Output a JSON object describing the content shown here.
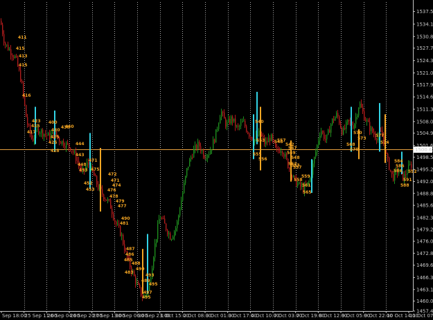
{
  "colors": {
    "background": "#000000",
    "bull": "#1e8c1e",
    "bear": "#b01c1c",
    "cyan_bar": "#33d4e6",
    "orange_bar": "#f5a623",
    "level_line": "#e8a040",
    "axis": "#c8c8c8",
    "grid": "#ffffff"
  },
  "chart_data": {
    "type": "candlestick",
    "ylim": [
      1457.4,
      1540.0
    ],
    "y_ticks": [
      "1537.50",
      "1534.10",
      "1530.80",
      "1527.70",
      "1524.35",
      "1521.05",
      "1517.95",
      "1514.65",
      "1511.35",
      "1508.05",
      "1504.95",
      "1501.65",
      "1498.55",
      "1495.25",
      "1492.05",
      "1488.85",
      "1485.65",
      "1482.35",
      "1479.25",
      "1476.05",
      "1472.85",
      "1469.65",
      "1466.35",
      "1463.15",
      "1460.05",
      "1457.40"
    ],
    "x_ticks": [
      "Sep 18:00",
      "25 Sep 11:00",
      "26 Sep 04:00",
      "26 Sep 20:00",
      "27 Sep 13:00",
      "30 Sep 06:00",
      "30 Sep 23:00",
      "1 Oct 15:00",
      "2 Oct 08:00",
      "3 Oct 01:00",
      "3 Oct 17:00",
      "4 Oct 10:00",
      "7 Oct 03:00",
      "7 Oct 19:00",
      "8 Oct 12:00",
      "9 Oct 05:00",
      "9 Oct 22:00",
      "10 Oct 14:00",
      "11 Oct 07:00"
    ],
    "level_line": 1500.6,
    "current_price_label": "1500.63",
    "path": [
      [
        0,
        1535
      ],
      [
        6,
        1529
      ],
      [
        14,
        1527
      ],
      [
        22,
        1525
      ],
      [
        30,
        1519
      ],
      [
        38,
        1508
      ],
      [
        46,
        1503
      ],
      [
        54,
        1506
      ],
      [
        62,
        1505
      ],
      [
        70,
        1504
      ],
      [
        78,
        1505
      ],
      [
        86,
        1503
      ],
      [
        94,
        1502
      ],
      [
        102,
        1501
      ],
      [
        110,
        1498
      ],
      [
        118,
        1494
      ],
      [
        126,
        1497
      ],
      [
        134,
        1494
      ],
      [
        142,
        1490
      ],
      [
        150,
        1488
      ],
      [
        158,
        1486
      ],
      [
        166,
        1481
      ],
      [
        174,
        1478
      ],
      [
        182,
        1472
      ],
      [
        190,
        1468
      ],
      [
        198,
        1464
      ],
      [
        206,
        1461
      ],
      [
        214,
        1463
      ],
      [
        222,
        1474
      ],
      [
        230,
        1483
      ],
      [
        238,
        1480
      ],
      [
        246,
        1477
      ],
      [
        254,
        1480
      ],
      [
        262,
        1488
      ],
      [
        270,
        1496
      ],
      [
        278,
        1500
      ],
      [
        286,
        1502
      ],
      [
        294,
        1499
      ],
      [
        302,
        1500
      ],
      [
        310,
        1504
      ],
      [
        318,
        1511
      ],
      [
        326,
        1507
      ],
      [
        334,
        1509
      ],
      [
        342,
        1506
      ],
      [
        350,
        1508
      ],
      [
        358,
        1505
      ],
      [
        366,
        1503
      ],
      [
        374,
        1505
      ],
      [
        382,
        1502
      ],
      [
        390,
        1504
      ],
      [
        398,
        1500
      ],
      [
        406,
        1501
      ],
      [
        414,
        1497
      ],
      [
        422,
        1493
      ],
      [
        430,
        1491
      ],
      [
        438,
        1490
      ],
      [
        446,
        1492
      ],
      [
        454,
        1499
      ],
      [
        462,
        1506
      ],
      [
        470,
        1503
      ],
      [
        478,
        1508
      ],
      [
        486,
        1510
      ],
      [
        494,
        1505
      ],
      [
        502,
        1508
      ],
      [
        510,
        1507
      ],
      [
        518,
        1513
      ],
      [
        526,
        1509
      ],
      [
        534,
        1506
      ],
      [
        542,
        1504
      ],
      [
        550,
        1505
      ],
      [
        558,
        1498
      ],
      [
        566,
        1493
      ],
      [
        574,
        1495
      ],
      [
        582,
        1493
      ],
      [
        590,
        1496
      ],
      [
        596,
        1497
      ]
    ],
    "cyan_bars": [
      [
        51,
        1512,
        1502
      ],
      [
        79,
        1511,
        1500
      ],
      [
        130,
        1505,
        1490
      ],
      [
        213,
        1478,
        1462
      ],
      [
        366,
        1510,
        1498
      ],
      [
        371,
        1516,
        1502
      ],
      [
        450,
        1498,
        1489
      ],
      [
        507,
        1512,
        1500
      ],
      [
        548,
        1513,
        1500
      ],
      [
        580,
        1500,
        1494
      ]
    ],
    "orange_bars": [
      [
        145,
        1501,
        1484
      ],
      [
        206,
        1474,
        1462
      ],
      [
        376,
        1512,
        1495
      ],
      [
        420,
        1503,
        1492
      ],
      [
        518,
        1506,
        1498
      ],
      [
        556,
        1510,
        1497
      ]
    ],
    "labels": [
      [
        "411",
        26,
        56
      ],
      [
        "415",
        23,
        72
      ],
      [
        "413",
        27,
        83
      ],
      [
        "415",
        27,
        96
      ],
      [
        "416",
        32,
        140
      ],
      [
        "417",
        39,
        193
      ],
      [
        "423",
        46,
        177
      ],
      [
        "425",
        45,
        184
      ],
      [
        "400",
        70,
        179
      ],
      [
        "430",
        74,
        190
      ],
      [
        "425",
        73,
        200
      ],
      [
        "425",
        70,
        208
      ],
      [
        "428",
        73,
        220
      ],
      [
        "430",
        88,
        186
      ],
      [
        "440",
        94,
        185
      ],
      [
        "444",
        109,
        210
      ],
      [
        "443",
        109,
        226
      ],
      [
        "448",
        112,
        240
      ],
      [
        "453",
        114,
        248
      ],
      [
        "452",
        121,
        267
      ],
      [
        "453",
        124,
        276
      ],
      [
        "471",
        128,
        234
      ],
      [
        "475",
        131,
        247
      ],
      [
        "472",
        156,
        254
      ],
      [
        "471",
        160,
        263
      ],
      [
        "474",
        162,
        270
      ],
      [
        "476",
        155,
        277
      ],
      [
        "478",
        158,
        286
      ],
      [
        "479",
        167,
        293
      ],
      [
        "477",
        170,
        300
      ],
      [
        "490",
        175,
        318
      ],
      [
        "481",
        173,
        325
      ],
      [
        "487",
        182,
        362
      ],
      [
        "486",
        181,
        370
      ],
      [
        "485",
        179,
        378
      ],
      [
        "488",
        190,
        383
      ],
      [
        "483",
        180,
        396
      ],
      [
        "490",
        196,
        391
      ],
      [
        "493",
        210,
        400
      ],
      [
        "489",
        204,
        408
      ],
      [
        "495",
        215,
        413
      ],
      [
        "497",
        207,
        425
      ],
      [
        "495",
        205,
        432
      ],
      [
        "540",
        368,
        178
      ],
      [
        "553",
        370,
        205
      ],
      [
        "555",
        365,
        225
      ],
      [
        "556",
        373,
        232
      ],
      [
        "548",
        396,
        207
      ],
      [
        "557",
        400,
        205
      ],
      [
        "542",
        412,
        211
      ],
      [
        "547",
        416,
        216
      ],
      [
        "549",
        414,
        223
      ],
      [
        "548",
        420,
        230
      ],
      [
        "552",
        416,
        239
      ],
      [
        "553",
        420,
        241
      ],
      [
        "557",
        423,
        244
      ],
      [
        "558",
        424,
        262
      ],
      [
        "559",
        435,
        257
      ],
      [
        "561",
        436,
        270
      ],
      [
        "565",
        437,
        280
      ],
      [
        "570",
        510,
        194
      ],
      [
        "573",
        516,
        202
      ],
      [
        "568",
        500,
        211
      ],
      [
        "570",
        505,
        218
      ],
      [
        "577",
        542,
        198
      ],
      [
        "574",
        549,
        208
      ],
      [
        "584",
        569,
        235
      ],
      [
        "586",
        571,
        242
      ],
      [
        "586",
        568,
        249
      ],
      [
        "588",
        578,
        270
      ],
      [
        "591",
        582,
        262
      ],
      [
        "592",
        589,
        250
      ]
    ]
  }
}
